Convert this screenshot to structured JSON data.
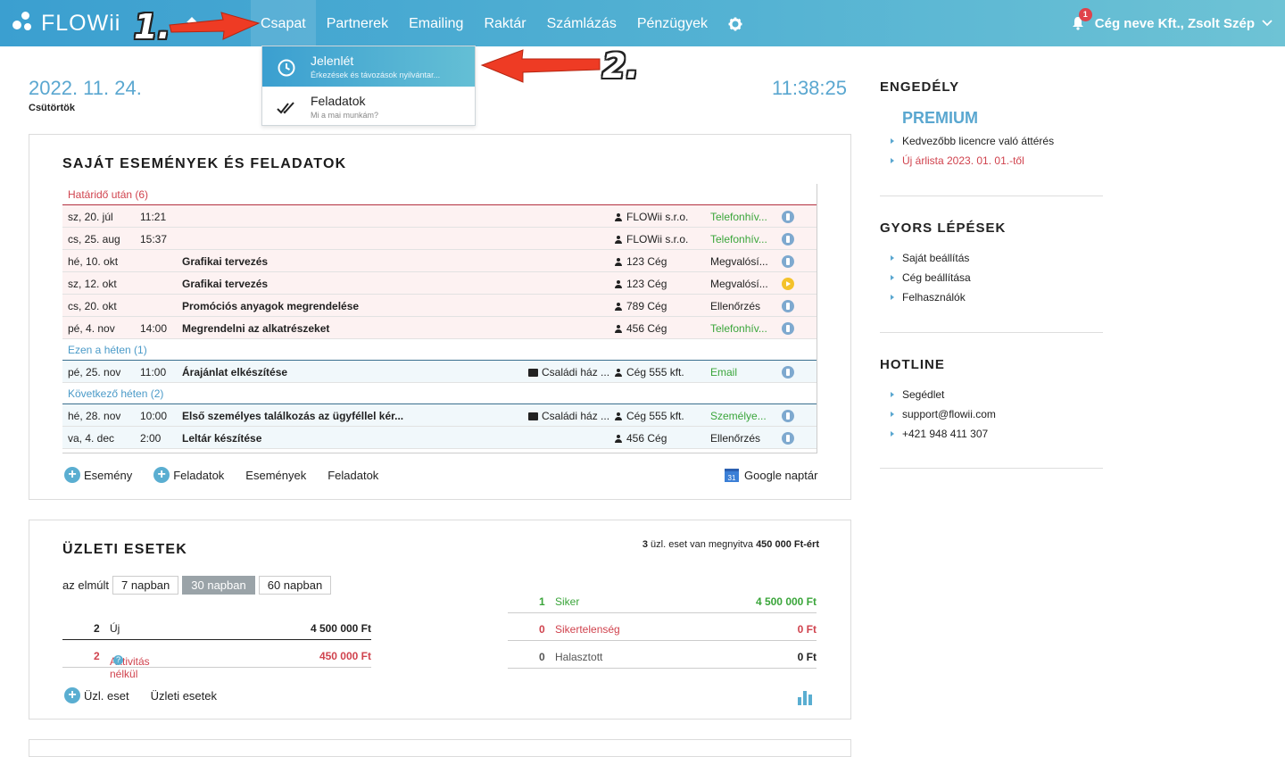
{
  "header": {
    "logo": "FLOWii",
    "nav": [
      "Csapat",
      "Partnerek",
      "Emailing",
      "Raktár",
      "Számlázás",
      "Pénzügyek"
    ],
    "notification_count": "1",
    "user": "Cég neve Kft., Zsolt Szép"
  },
  "dropdown": [
    {
      "title": "Jelenlét",
      "sub": "Érkezések és távozások nyilvántar..."
    },
    {
      "title": "Feladatok",
      "sub": "Mi a mai munkám?"
    }
  ],
  "annotations": {
    "one": "1.",
    "two": "2."
  },
  "datetime": {
    "date": "2022. 11. 24.",
    "weekday": "Csütörtök",
    "time": "11:38:25"
  },
  "events": {
    "title": "SAJÁT ESEMÉNYEK ÉS FELADATOK",
    "groups": [
      {
        "label": "Határidő után (6)",
        "rows": [
          {
            "date": "sz, 20. júl",
            "time": "11:21",
            "title": "",
            "extra": "",
            "company": "FLOWii s.r.o.",
            "status": "Telefonhív..."
          },
          {
            "date": "cs, 25. aug",
            "time": "15:37",
            "title": "",
            "extra": "",
            "company": "FLOWii s.r.o.",
            "status": "Telefonhív..."
          },
          {
            "date": "hé, 10. okt",
            "time": "",
            "title": "Grafikai tervezés",
            "extra": "",
            "company": "123 Cég",
            "status": "Megvalósí..."
          },
          {
            "date": "sz, 12. okt",
            "time": "",
            "title": "Grafikai tervezés",
            "extra": "",
            "company": "123 Cég",
            "status": "Megvalósí..."
          },
          {
            "date": "cs, 20. okt",
            "time": "",
            "title": "Promóciós anyagok megrendelése",
            "extra": "",
            "company": "789 Cég",
            "status": "Ellenőrzés"
          },
          {
            "date": "pé, 4. nov",
            "time": "14:00",
            "title": "Megrendelni az alkatrészeket",
            "extra": "",
            "company": "456 Cég",
            "status": "Telefonhív..."
          }
        ]
      },
      {
        "label": "Ezen a héten (1)",
        "rows": [
          {
            "date": "pé, 25. nov",
            "time": "11:00",
            "title": "Árajánlat elkészítése",
            "extra": "Családi ház ...",
            "company": "Cég 555 kft.",
            "status": "Email"
          }
        ]
      },
      {
        "label": "Következő héten (2)",
        "rows": [
          {
            "date": "hé, 28. nov",
            "time": "10:00",
            "title": "Első személyes találkozás az ügyféllel kér...",
            "extra": "Családi ház ...",
            "company": "Cég 555 kft.",
            "status": "Személye..."
          },
          {
            "date": "va, 4. dec",
            "time": "2:00",
            "title": "Leltár készítése",
            "extra": "",
            "company": "456 Cég",
            "status": "Ellenőrzés"
          }
        ]
      }
    ],
    "links": [
      "Esemény",
      "Feladatok",
      "Események",
      "Feladatok"
    ],
    "gcal": "Google naptár",
    "gcal_day": "31"
  },
  "business": {
    "title": "ÜZLETI ESETEK",
    "summary_count": "3",
    "summary_mid": " üzl. eset van megnyitva ",
    "summary_amount": "450 000 Ft-ért",
    "period_label": "az elmúlt",
    "periods": [
      "7 napban",
      "30 napban",
      "60 napban"
    ],
    "left": [
      {
        "n": "2",
        "label": "Új",
        "value": "4 500 000 Ft"
      },
      {
        "n": "2",
        "label": "Aktivitás nélkül",
        "value": "450 000 Ft"
      }
    ],
    "right": [
      {
        "n": "1",
        "label": "Siker",
        "value": "4 500 000 Ft"
      },
      {
        "n": "0",
        "label": "Sikertelenség",
        "value": "0 Ft"
      },
      {
        "n": "0",
        "label": "Halasztott",
        "value": "0 Ft"
      }
    ],
    "links": [
      "Üzl. eset",
      "Üzleti esetek"
    ]
  },
  "sidebar": {
    "license_title": "ENGEDÉLY",
    "plan": "PREMIUM",
    "license_items": [
      "Kedvezőbb licencre való áttérés",
      "Új árlista 2023. 01. 01.-től"
    ],
    "quick_title": "GYORS LÉPÉSEK",
    "quick_items": [
      "Saját beállítás",
      "Cég beállítása",
      "Felhasználók"
    ],
    "hotline_title": "HOTLINE",
    "hotline_items": [
      "Segédlet",
      "support@flowii.com",
      "+421 948 411 307"
    ]
  },
  "colors": {
    "accent": "#3b9fd0",
    "red": "#d0434e",
    "green": "#3aa53a"
  }
}
